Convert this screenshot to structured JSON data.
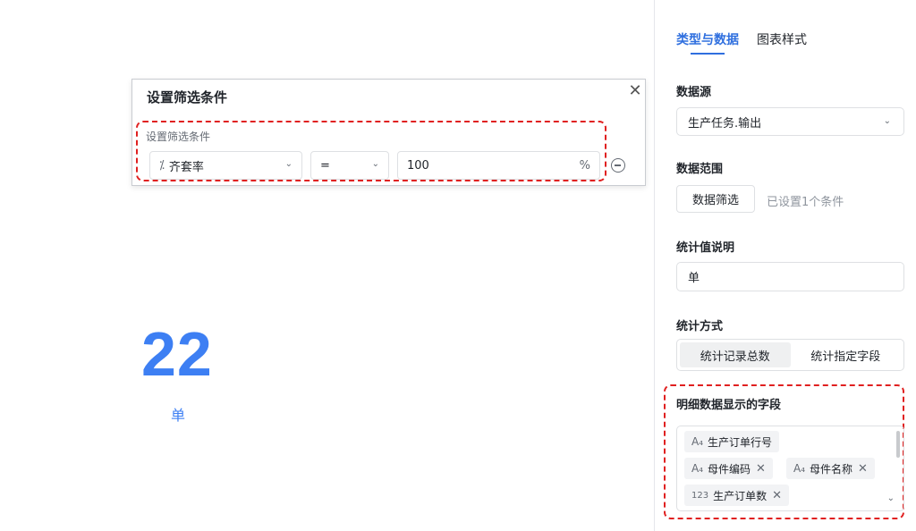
{
  "preview": {
    "value": "22",
    "unit": "单"
  },
  "filter_popup": {
    "title": "设置筛选条件",
    "condition_label": "设置筛选条件",
    "field_icon": "⁒",
    "field": "齐套率",
    "operator": "=",
    "value": "100",
    "value_suffix": "%"
  },
  "panel": {
    "tabs": [
      {
        "label": "类型与数据",
        "active": true
      },
      {
        "label": "图表样式",
        "active": false
      }
    ],
    "datasource": {
      "title": "数据源",
      "value": "生产任务.输出"
    },
    "range": {
      "title": "数据范围",
      "button": "数据筛选",
      "status": "已设置1个条件"
    },
    "stat_desc": {
      "title": "统计值说明",
      "value": "单"
    },
    "stat_method": {
      "title": "统计方式",
      "options": [
        "统计记录总数",
        "统计指定字段"
      ],
      "selected": 0
    },
    "detail_fields": {
      "title": "明细数据显示的字段",
      "tags": [
        {
          "icon": "A₄",
          "label": "生产订单行号",
          "removable": false
        },
        {
          "icon": "A₄",
          "label": "母件编码",
          "removable": true
        },
        {
          "icon": "A₄",
          "label": "母件名称",
          "removable": true
        },
        {
          "icon": "123",
          "label": "生产订单数",
          "removable": true
        }
      ]
    }
  },
  "colors": {
    "accent": "#3d7ff3",
    "tab_active": "#2f6fdf",
    "highlight_dash": "#e02020"
  }
}
